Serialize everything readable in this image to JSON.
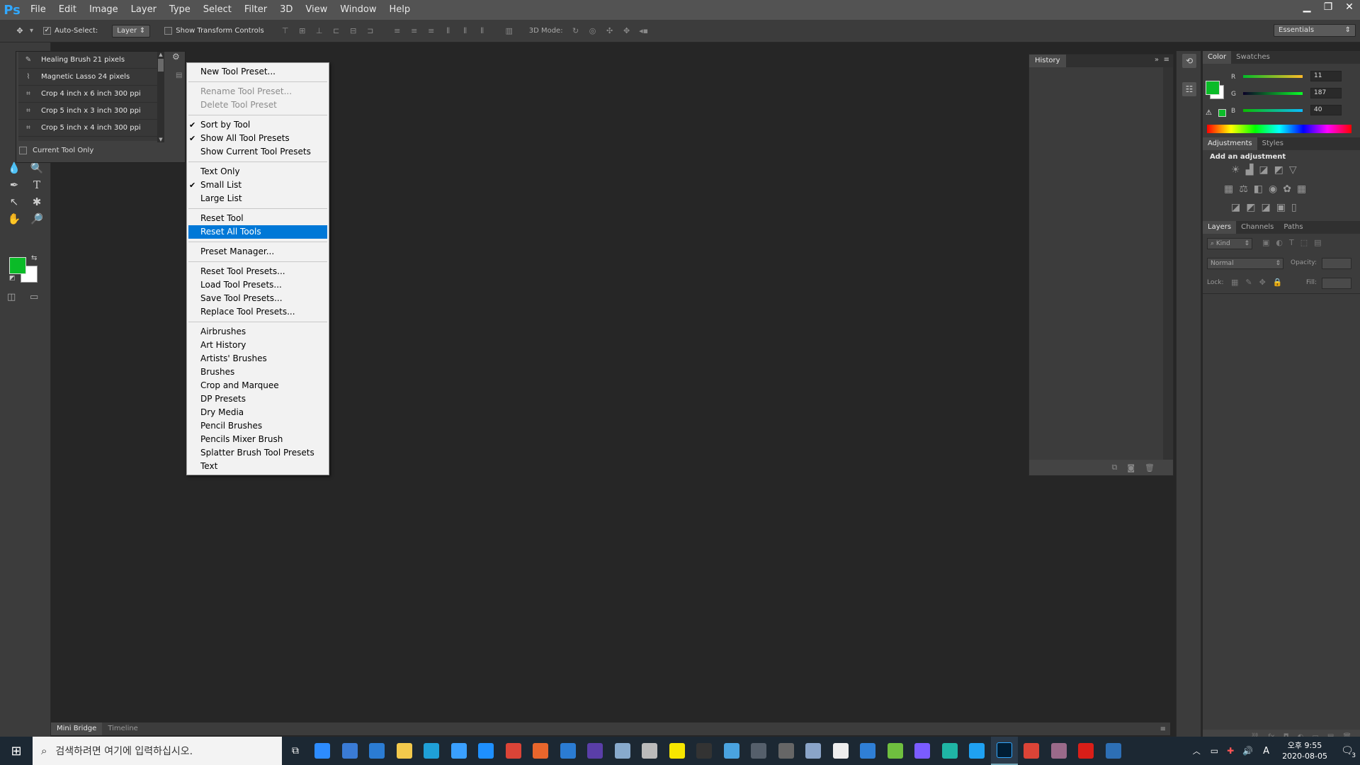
{
  "menubar": {
    "logo": "Ps",
    "items": [
      "File",
      "Edit",
      "Image",
      "Layer",
      "Type",
      "Select",
      "Filter",
      "3D",
      "View",
      "Window",
      "Help"
    ]
  },
  "options": {
    "auto_select_label": "Auto-Select:",
    "auto_select_value": "Layer",
    "show_transform_label": "Show Transform Controls",
    "mode_3d_label": "3D Mode:",
    "workspace": "Essentials"
  },
  "tool_presets": {
    "rows": [
      "Healing Brush 21 pixels",
      "Magnetic Lasso 24 pixels",
      "Crop 4 inch x 6 inch 300 ppi",
      "Crop 5 inch x 3 inch 300 ppi",
      "Crop 5 inch x 4 inch 300 ppi"
    ],
    "current_tool_only": "Current Tool Only"
  },
  "context_menu": {
    "groups": [
      [
        {
          "label": "New Tool Preset...",
          "check": false,
          "disabled": false
        }
      ],
      [
        {
          "label": "Rename Tool Preset...",
          "check": false,
          "disabled": true
        },
        {
          "label": "Delete Tool Preset",
          "check": false,
          "disabled": true
        }
      ],
      [
        {
          "label": "Sort by Tool",
          "check": true,
          "disabled": false
        },
        {
          "label": "Show All Tool Presets",
          "check": true,
          "disabled": false
        },
        {
          "label": "Show Current Tool Presets",
          "check": false,
          "disabled": false
        }
      ],
      [
        {
          "label": "Text Only",
          "check": false,
          "disabled": false
        },
        {
          "label": "Small List",
          "check": true,
          "disabled": false
        },
        {
          "label": "Large List",
          "check": false,
          "disabled": false
        }
      ],
      [
        {
          "label": "Reset Tool",
          "check": false,
          "disabled": false
        },
        {
          "label": "Reset All Tools",
          "check": false,
          "disabled": false,
          "selected": true
        }
      ],
      [
        {
          "label": "Preset Manager...",
          "check": false,
          "disabled": false
        }
      ],
      [
        {
          "label": "Reset Tool Presets...",
          "check": false,
          "disabled": false
        },
        {
          "label": "Load Tool Presets...",
          "check": false,
          "disabled": false
        },
        {
          "label": "Save Tool Presets...",
          "check": false,
          "disabled": false
        },
        {
          "label": "Replace Tool Presets...",
          "check": false,
          "disabled": false
        }
      ],
      [
        {
          "label": "Airbrushes"
        },
        {
          "label": "Art History"
        },
        {
          "label": "Artists' Brushes"
        },
        {
          "label": "Brushes"
        },
        {
          "label": "Crop and Marquee"
        },
        {
          "label": "DP Presets"
        },
        {
          "label": "Dry Media"
        },
        {
          "label": "Pencil Brushes"
        },
        {
          "label": "Pencils Mixer Brush"
        },
        {
          "label": "Splatter Brush Tool Presets"
        },
        {
          "label": "Text"
        }
      ]
    ]
  },
  "history": {
    "tab": "History"
  },
  "color_panel": {
    "tabs": [
      "Color",
      "Swatches"
    ],
    "r_label": "R",
    "g_label": "G",
    "b_label": "B",
    "r": "11",
    "g": "187",
    "b": "40",
    "fg_color": "#0bbb28"
  },
  "adjustments": {
    "tabs": [
      "Adjustments",
      "Styles"
    ],
    "title": "Add an adjustment"
  },
  "layers": {
    "tabs": [
      "Layers",
      "Channels",
      "Paths"
    ],
    "kind": "Kind",
    "blend": "Normal",
    "opacity_label": "Opacity:",
    "lock_label": "Lock:",
    "fill_label": "Fill:"
  },
  "bottom": {
    "tabs": [
      "Mini Bridge",
      "Timeline"
    ]
  },
  "taskbar": {
    "search_placeholder": "검색하려면 여기에 입력하십시오.",
    "time": "오후 9:55",
    "date": "2020-08-05",
    "ime": "A",
    "notif_count": "3"
  }
}
